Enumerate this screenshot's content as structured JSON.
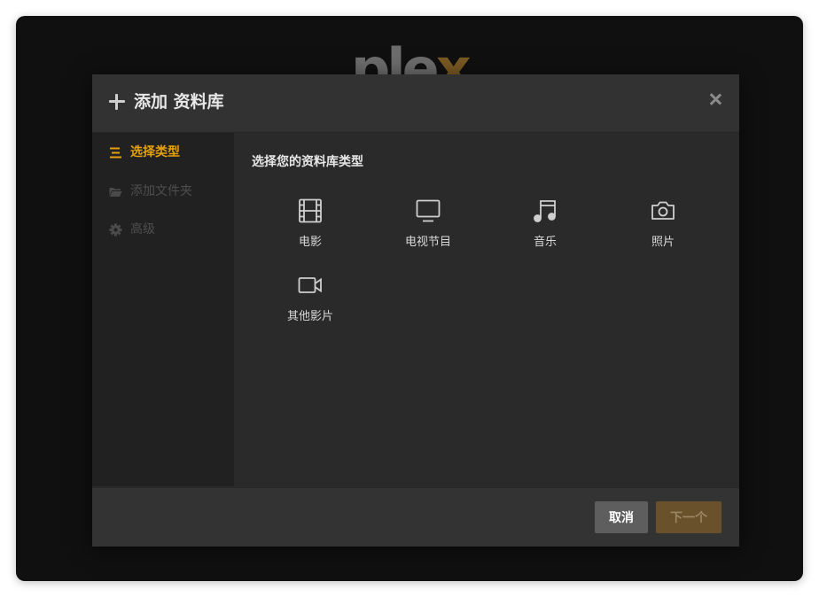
{
  "app": {
    "logo_text": "ple",
    "logo_accent": "x"
  },
  "modal": {
    "title": "添加 资料库",
    "steps": [
      {
        "label": "选择类型",
        "icon": "list-icon",
        "state": "active"
      },
      {
        "label": "添加文件夹",
        "icon": "folder-icon",
        "state": "disabled"
      },
      {
        "label": "高级",
        "icon": "gear-icon",
        "state": "disabled"
      }
    ],
    "content": {
      "heading": "选择您的资料库类型",
      "types": [
        {
          "label": "电影",
          "icon": "film-icon"
        },
        {
          "label": "电视节目",
          "icon": "tv-icon"
        },
        {
          "label": "音乐",
          "icon": "music-note-icon"
        },
        {
          "label": "照片",
          "icon": "camera-icon"
        },
        {
          "label": "其他影片",
          "icon": "video-camera-icon"
        }
      ]
    },
    "footer": {
      "cancel_label": "取消",
      "next_label": "下一个"
    }
  },
  "colors": {
    "accent": "#e5a00d",
    "background": "#101010",
    "modal": "#2a2a2a"
  }
}
